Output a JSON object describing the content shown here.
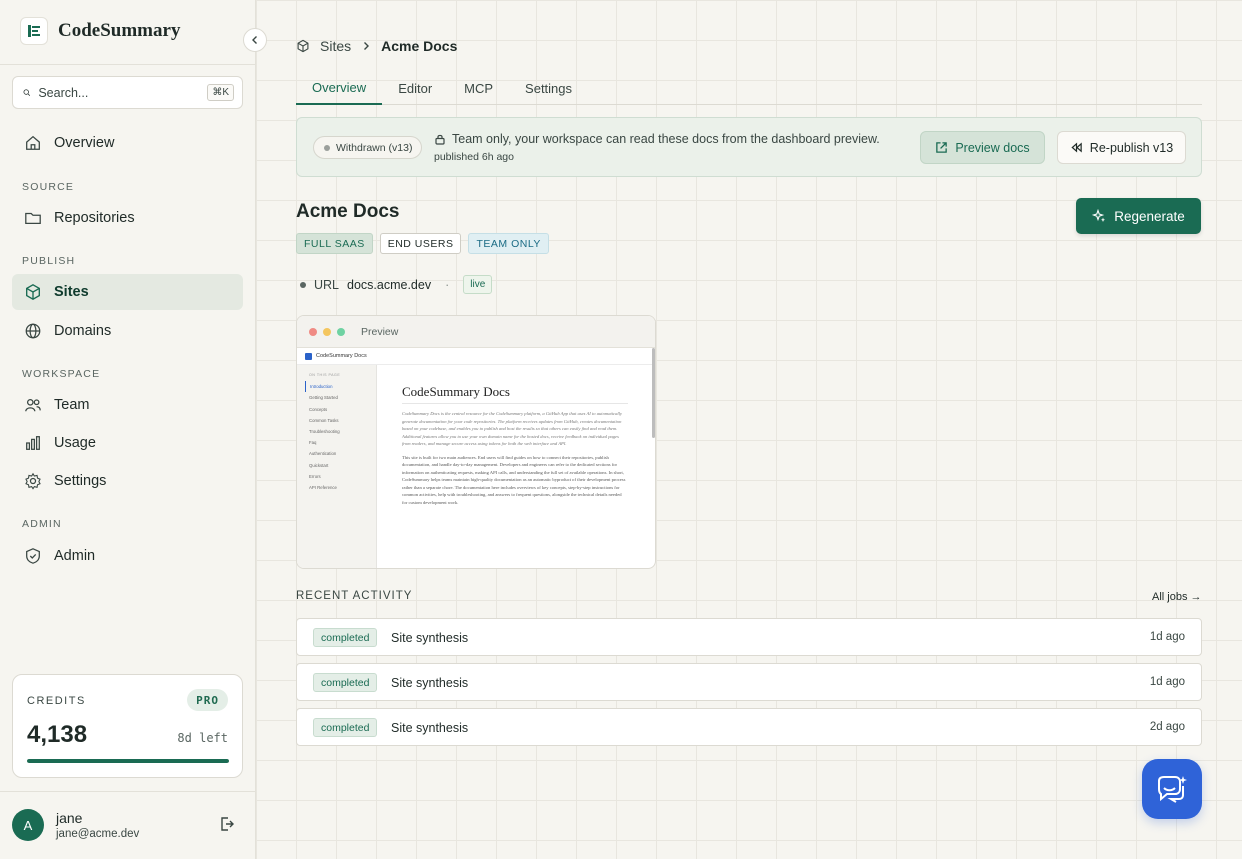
{
  "brand": {
    "name": "CodeSummary"
  },
  "search": {
    "placeholder": "Search...",
    "shortcut": "⌘K"
  },
  "sidebar": {
    "overview": "Overview",
    "sections": {
      "source": "SOURCE",
      "publish": "PUBLISH",
      "workspace": "WORKSPACE",
      "admin": "ADMIN"
    },
    "items": {
      "repositories": "Repositories",
      "sites": "Sites",
      "domains": "Domains",
      "team": "Team",
      "usage": "Usage",
      "settings": "Settings",
      "admin": "Admin"
    }
  },
  "credits": {
    "label": "CREDITS",
    "plan": "PRO",
    "value": "4,138",
    "left": "8d left",
    "fraction": 1.0
  },
  "user": {
    "initial": "A",
    "name": "jane",
    "email": "jane@acme.dev"
  },
  "breadcrumb": {
    "root": "Sites",
    "current": "Acme Docs"
  },
  "tabs": [
    "Overview",
    "Editor",
    "MCP",
    "Settings"
  ],
  "banner": {
    "status": "Withdrawn (v13)",
    "message": "Team only, your workspace can read these docs from the dashboard preview.",
    "sub": "published 6h ago",
    "preview_label": "Preview docs",
    "republish_label": "Re-publish v13"
  },
  "site": {
    "title": "Acme Docs",
    "regenerate_label": "Regenerate",
    "tags": [
      "FULL SAAS",
      "END USERS",
      "TEAM ONLY"
    ],
    "url_label": "URL",
    "url": "docs.acme.dev",
    "separator": "·",
    "url_status": "live"
  },
  "preview": {
    "label": "Preview",
    "site_name": "CodeSummary Docs",
    "nav_heading": "ON THIS PAGE",
    "nav": [
      "Introduction",
      "Getting Started",
      "Concepts",
      "Common Tasks",
      "Troubleshooting",
      "Faq",
      "Authentication",
      "Quickstart",
      "Errors",
      "API Reference"
    ],
    "heading": "CodeSummary Docs",
    "para1": "CodeSummary Docs is the central resource for the CodeSummary platform, a GitHub App that uses AI to automatically generate documentation for your code repositories. The platform receives updates from GitHub, creates documentation based on your codebase, and enables you to publish and host the results so that others can easily find and read them. Additional features allow you to use your own domain name for the hosted docs, receive feedback on individual pages from readers, and manage secure access using tokens for both the web interface and API.",
    "para2": "This site is built for two main audiences. End users will find guides on how to connect their repositories, publish documentation, and handle day-to-day management. Developers and engineers can refer to the dedicated sections for information on authenticating requests, making API calls, and understanding the full set of available operations. In short, CodeSummary helps teams maintain high-quality documentation as an automatic byproduct of their development process rather than a separate chore. The documentation here includes overviews of key concepts, step-by-step instructions for common activities, help with troubleshooting, and answers to frequent questions, alongside the technical details needed for custom development work."
  },
  "activity": {
    "label": "RECENT ACTIVITY",
    "all_jobs": "All jobs →",
    "rows": [
      {
        "status": "completed",
        "name": "Site synthesis",
        "time": "1d ago"
      },
      {
        "status": "completed",
        "name": "Site synthesis",
        "time": "1d ago"
      },
      {
        "status": "completed",
        "name": "Site synthesis",
        "time": "2d ago"
      }
    ]
  },
  "colors": {
    "accent": "#1a6b53",
    "chat": "#2f63d8"
  }
}
